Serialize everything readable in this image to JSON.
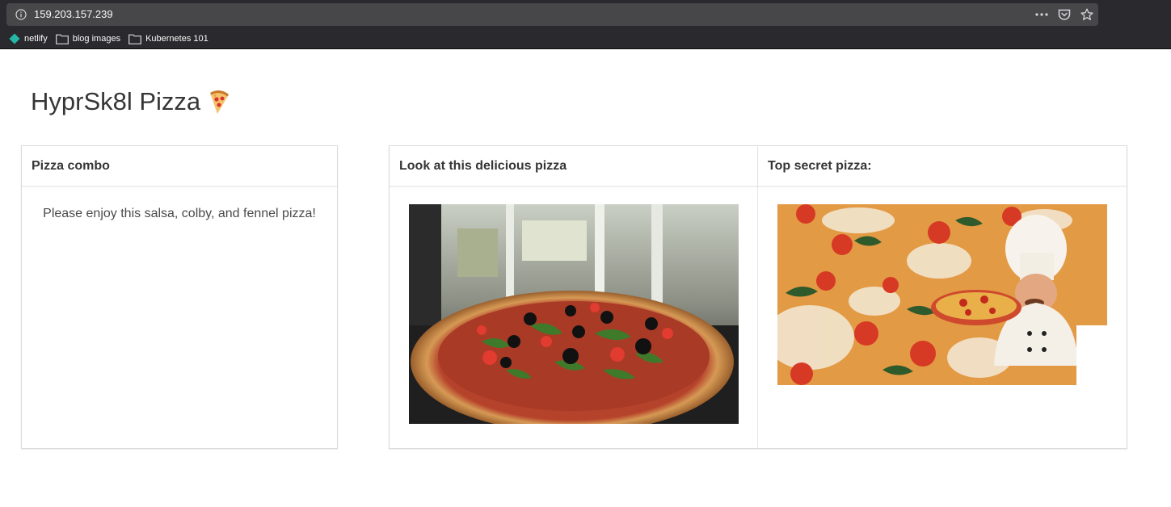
{
  "browser": {
    "url": "159.203.157.239",
    "bookmarks": [
      {
        "label": "netlify",
        "icon": "netlify-icon"
      },
      {
        "label": "blog images",
        "icon": "folder-icon"
      },
      {
        "label": "Kubernetes 101",
        "icon": "folder-icon"
      }
    ],
    "actions": [
      "more-actions-icon",
      "pocket-icon",
      "star-icon"
    ]
  },
  "page": {
    "title": "HyprSk8l Pizza",
    "title_emoji": "pizza-slice-icon"
  },
  "cards": {
    "combo": {
      "header": "Pizza combo",
      "text": "Please enjoy this salsa, colby, and fennel pizza!"
    },
    "delicious": {
      "header": "Look at this delicious pizza",
      "image": "pizza-photo"
    },
    "secret": {
      "header": "Top secret pizza:",
      "image": "chef-pizza-photo"
    }
  },
  "colors": {
    "chrome_bg": "#2a2a2e",
    "urlbar_bg": "#474749",
    "text": "#363636",
    "border": "#dbdbdb",
    "netlify": "#25b7a6"
  }
}
